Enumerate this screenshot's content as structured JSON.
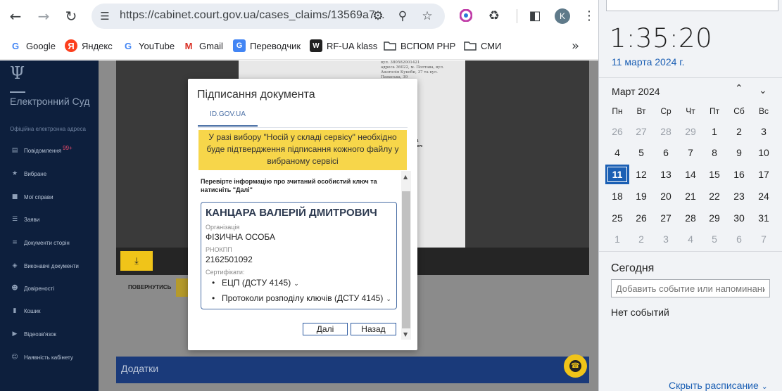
{
  "browser": {
    "url": "https://cabinet.court.gov.ua/cases_claims/13569a7...",
    "profile_initial": "K",
    "bookmarks": [
      {
        "label": "Google",
        "icon": "google-icon"
      },
      {
        "label": "Яндекс",
        "icon": "yandex-icon"
      },
      {
        "label": "YouTube",
        "icon": "google-icon"
      },
      {
        "label": "Gmail",
        "icon": "gmail-icon"
      },
      {
        "label": "Переводчик",
        "icon": "translate-icon"
      },
      {
        "label": "RF-UA klass",
        "icon": "w-icon"
      },
      {
        "label": "ВСПОМ PHP",
        "icon": "folder-icon"
      },
      {
        "label": "СМИ",
        "icon": "folder-icon"
      }
    ]
  },
  "sidebar": {
    "title": "Електронний Суд",
    "subtitle": "Офіційна електронна адреса",
    "items": [
      {
        "label": "Повідомлення",
        "badge": "99+",
        "icon": "message-icon"
      },
      {
        "label": "Вибране",
        "icon": "star-icon"
      },
      {
        "label": "Мої справи",
        "icon": "folder-icon"
      },
      {
        "label": "Заяви",
        "icon": "list-icon"
      },
      {
        "label": "Документи сторін",
        "icon": "doc-list-icon"
      },
      {
        "label": "Виконавчі документи",
        "icon": "layers-icon"
      },
      {
        "label": "Довіреності",
        "icon": "users-icon"
      },
      {
        "label": "Кошик",
        "icon": "trash-icon"
      },
      {
        "label": "Відеозв'язок",
        "icon": "video-icon"
      },
      {
        "label": "Наявність кабінету",
        "icon": "user-check-icon"
      }
    ]
  },
  "page": {
    "back_label": "ПОВЕРНУТИСЬ",
    "attachments_label": "Додатки",
    "doc_lines": [
      "вул. 380582001421",
      "адреса 36022, м. Полтава, вул.",
      "Анатолія Кукоби, 37 та вул.",
      "Панаська, 39",
      "",
      "...прокурора",
      "...gov.ua",
      "...4",
      "...шана дом.13/15,",
      "",
      "...1",
      "",
      "...333/17",
      "...2/553/691/2024",
      "...Руслан Ігорович"
    ]
  },
  "modal": {
    "title": "Підписання документа",
    "tab": "ID.GOV.UA",
    "notice": "У разі вибору \"Носій у складі сервісу\" необхідно буде підтвердження підписання кожного файлу у вибраному сервісі",
    "check_text": "Перевірте інформацію про зчитаний особистий ключ та натисніть \"Далі\"",
    "holder_name": "КАНЦАРА ВАЛЕРІЙ ДМИТРОВИЧ",
    "org_label": "Організація",
    "org_value": "ФІЗИЧНА ОСОБА",
    "rnokpp_label": "РНОКПП",
    "rnokpp_value": "2162501092",
    "certs_label": "Сертифікати:",
    "certs": [
      "ЕЦП (ДСТУ 4145)",
      "Протоколи розподілу ключів (ДСТУ 4145)"
    ],
    "next_label": "Далі",
    "back_label": "Назад"
  },
  "calendar": {
    "time": "1:35:20",
    "date": "11 марта 2024 г.",
    "month": "Март 2024",
    "weekdays": [
      "Пн",
      "Вт",
      "Ср",
      "Чт",
      "Пт",
      "Сб",
      "Вс"
    ],
    "weeks": [
      [
        "26",
        "27",
        "28",
        "29",
        "1",
        "2",
        "3"
      ],
      [
        "4",
        "5",
        "6",
        "7",
        "8",
        "9",
        "10"
      ],
      [
        "11",
        "12",
        "13",
        "14",
        "15",
        "16",
        "17"
      ],
      [
        "18",
        "19",
        "20",
        "21",
        "22",
        "23",
        "24"
      ],
      [
        "25",
        "26",
        "27",
        "28",
        "29",
        "30",
        "31"
      ],
      [
        "1",
        "2",
        "3",
        "4",
        "5",
        "6",
        "7"
      ]
    ],
    "today_label": "Сегодня",
    "event_placeholder": "Добавить событие или напоминание",
    "no_events": "Нет событий",
    "hide_schedule": "Скрыть расписание"
  }
}
